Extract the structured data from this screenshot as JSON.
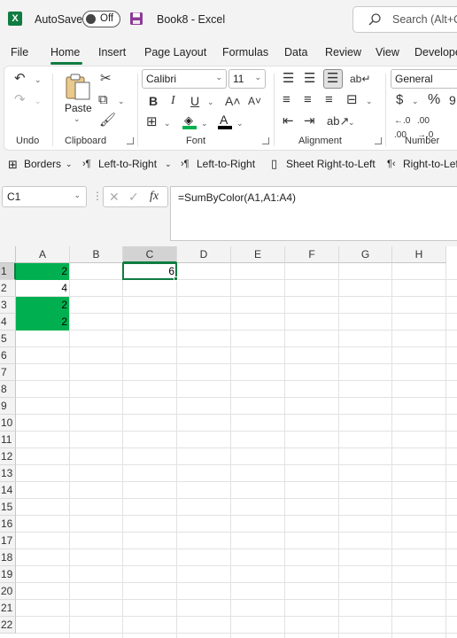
{
  "app": {
    "autosave_label": "AutoSave",
    "autosave_state": "Off",
    "doc_title": "Book8  -  Excel",
    "search_placeholder": "Search (Alt+Q)",
    "accent_color": "#107c41"
  },
  "tabs": [
    "File",
    "Home",
    "Insert",
    "Page Layout",
    "Formulas",
    "Data",
    "Review",
    "View",
    "Developer"
  ],
  "active_tab": "Home",
  "ribbon": {
    "groups": {
      "undo": "Undo",
      "clipboard": "Clipboard",
      "font": "Font",
      "alignment": "Alignment",
      "number": "Number"
    },
    "paste_label": "Paste",
    "font_name": "Calibri",
    "font_size": "11",
    "number_format": "General"
  },
  "quick_toolbar": {
    "borders": "Borders",
    "ltr1": "Left-to-Right",
    "ltr2": "Left-to-Right",
    "sheet_rtl": "Sheet Right-to-Left",
    "rtl": "Right-to-Left"
  },
  "formula_bar": {
    "name_box": "C1",
    "formula": "=SumByColor(A1,A1:A4)",
    "fx": "fx"
  },
  "sheet": {
    "columns": [
      "A",
      "B",
      "C",
      "D",
      "E",
      "F",
      "G",
      "H"
    ],
    "rows": [
      "1",
      "2",
      "3",
      "4",
      "5",
      "6",
      "7",
      "8",
      "9",
      "10",
      "11",
      "12",
      "13",
      "14",
      "15",
      "16",
      "17",
      "18",
      "19",
      "20",
      "21",
      "22"
    ],
    "selected_cell": "C1",
    "fill_color": "#00b050",
    "cells": {
      "A1": "2",
      "A2": "4",
      "A3": "2",
      "A4": "2",
      "C1": "6"
    }
  }
}
